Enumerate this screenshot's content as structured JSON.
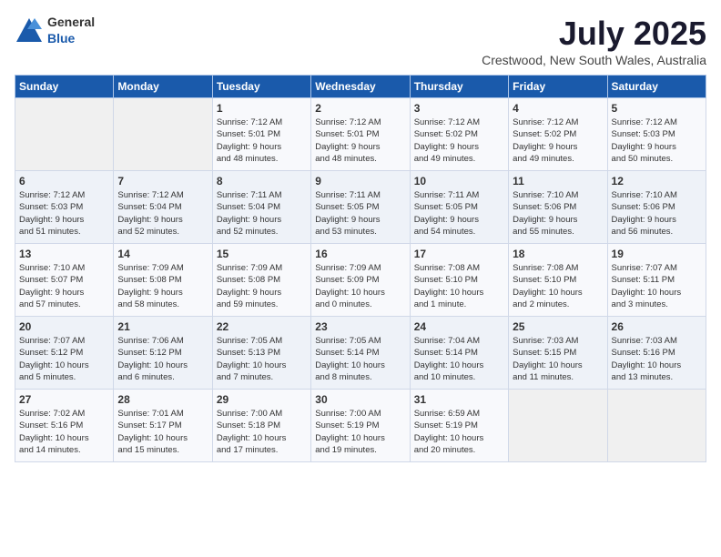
{
  "header": {
    "logo": {
      "general": "General",
      "blue": "Blue"
    },
    "title": "July 2025",
    "subtitle": "Crestwood, New South Wales, Australia"
  },
  "weekdays": [
    "Sunday",
    "Monday",
    "Tuesday",
    "Wednesday",
    "Thursday",
    "Friday",
    "Saturday"
  ],
  "weeks": [
    [
      {
        "day": "",
        "info": ""
      },
      {
        "day": "",
        "info": ""
      },
      {
        "day": "1",
        "info": "Sunrise: 7:12 AM\nSunset: 5:01 PM\nDaylight: 9 hours\nand 48 minutes."
      },
      {
        "day": "2",
        "info": "Sunrise: 7:12 AM\nSunset: 5:01 PM\nDaylight: 9 hours\nand 48 minutes."
      },
      {
        "day": "3",
        "info": "Sunrise: 7:12 AM\nSunset: 5:02 PM\nDaylight: 9 hours\nand 49 minutes."
      },
      {
        "day": "4",
        "info": "Sunrise: 7:12 AM\nSunset: 5:02 PM\nDaylight: 9 hours\nand 49 minutes."
      },
      {
        "day": "5",
        "info": "Sunrise: 7:12 AM\nSunset: 5:03 PM\nDaylight: 9 hours\nand 50 minutes."
      }
    ],
    [
      {
        "day": "6",
        "info": "Sunrise: 7:12 AM\nSunset: 5:03 PM\nDaylight: 9 hours\nand 51 minutes."
      },
      {
        "day": "7",
        "info": "Sunrise: 7:12 AM\nSunset: 5:04 PM\nDaylight: 9 hours\nand 52 minutes."
      },
      {
        "day": "8",
        "info": "Sunrise: 7:11 AM\nSunset: 5:04 PM\nDaylight: 9 hours\nand 52 minutes."
      },
      {
        "day": "9",
        "info": "Sunrise: 7:11 AM\nSunset: 5:05 PM\nDaylight: 9 hours\nand 53 minutes."
      },
      {
        "day": "10",
        "info": "Sunrise: 7:11 AM\nSunset: 5:05 PM\nDaylight: 9 hours\nand 54 minutes."
      },
      {
        "day": "11",
        "info": "Sunrise: 7:10 AM\nSunset: 5:06 PM\nDaylight: 9 hours\nand 55 minutes."
      },
      {
        "day": "12",
        "info": "Sunrise: 7:10 AM\nSunset: 5:06 PM\nDaylight: 9 hours\nand 56 minutes."
      }
    ],
    [
      {
        "day": "13",
        "info": "Sunrise: 7:10 AM\nSunset: 5:07 PM\nDaylight: 9 hours\nand 57 minutes."
      },
      {
        "day": "14",
        "info": "Sunrise: 7:09 AM\nSunset: 5:08 PM\nDaylight: 9 hours\nand 58 minutes."
      },
      {
        "day": "15",
        "info": "Sunrise: 7:09 AM\nSunset: 5:08 PM\nDaylight: 9 hours\nand 59 minutes."
      },
      {
        "day": "16",
        "info": "Sunrise: 7:09 AM\nSunset: 5:09 PM\nDaylight: 10 hours\nand 0 minutes."
      },
      {
        "day": "17",
        "info": "Sunrise: 7:08 AM\nSunset: 5:10 PM\nDaylight: 10 hours\nand 1 minute."
      },
      {
        "day": "18",
        "info": "Sunrise: 7:08 AM\nSunset: 5:10 PM\nDaylight: 10 hours\nand 2 minutes."
      },
      {
        "day": "19",
        "info": "Sunrise: 7:07 AM\nSunset: 5:11 PM\nDaylight: 10 hours\nand 3 minutes."
      }
    ],
    [
      {
        "day": "20",
        "info": "Sunrise: 7:07 AM\nSunset: 5:12 PM\nDaylight: 10 hours\nand 5 minutes."
      },
      {
        "day": "21",
        "info": "Sunrise: 7:06 AM\nSunset: 5:12 PM\nDaylight: 10 hours\nand 6 minutes."
      },
      {
        "day": "22",
        "info": "Sunrise: 7:05 AM\nSunset: 5:13 PM\nDaylight: 10 hours\nand 7 minutes."
      },
      {
        "day": "23",
        "info": "Sunrise: 7:05 AM\nSunset: 5:14 PM\nDaylight: 10 hours\nand 8 minutes."
      },
      {
        "day": "24",
        "info": "Sunrise: 7:04 AM\nSunset: 5:14 PM\nDaylight: 10 hours\nand 10 minutes."
      },
      {
        "day": "25",
        "info": "Sunrise: 7:03 AM\nSunset: 5:15 PM\nDaylight: 10 hours\nand 11 minutes."
      },
      {
        "day": "26",
        "info": "Sunrise: 7:03 AM\nSunset: 5:16 PM\nDaylight: 10 hours\nand 13 minutes."
      }
    ],
    [
      {
        "day": "27",
        "info": "Sunrise: 7:02 AM\nSunset: 5:16 PM\nDaylight: 10 hours\nand 14 minutes."
      },
      {
        "day": "28",
        "info": "Sunrise: 7:01 AM\nSunset: 5:17 PM\nDaylight: 10 hours\nand 15 minutes."
      },
      {
        "day": "29",
        "info": "Sunrise: 7:00 AM\nSunset: 5:18 PM\nDaylight: 10 hours\nand 17 minutes."
      },
      {
        "day": "30",
        "info": "Sunrise: 7:00 AM\nSunset: 5:19 PM\nDaylight: 10 hours\nand 19 minutes."
      },
      {
        "day": "31",
        "info": "Sunrise: 6:59 AM\nSunset: 5:19 PM\nDaylight: 10 hours\nand 20 minutes."
      },
      {
        "day": "",
        "info": ""
      },
      {
        "day": "",
        "info": ""
      }
    ]
  ]
}
